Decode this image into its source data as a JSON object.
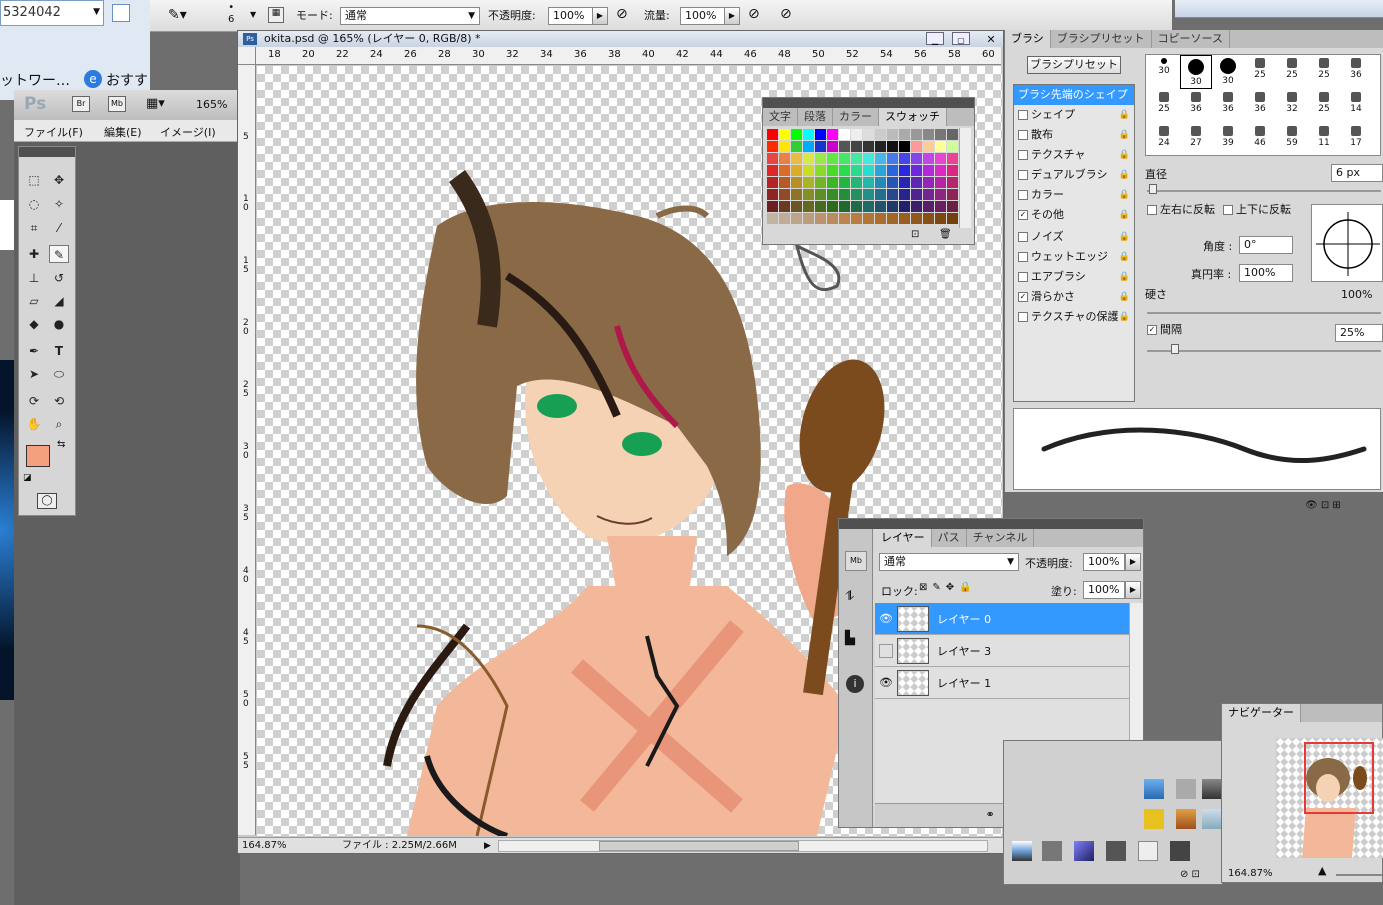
{
  "colors": {
    "accent": "#3399ff",
    "fg_swatch": "#f4a07e"
  },
  "browser": {
    "number": "5324042",
    "network": "ットワー…",
    "favorites": "おすすめサイト"
  },
  "options": {
    "mode_label": "モード:",
    "mode_value": "通常",
    "opacity_label": "不透明度:",
    "opacity_value": "100%",
    "flow_label": "流量:",
    "flow_value": "100%",
    "brush_size": "6"
  },
  "app": {
    "ps_logo": "Ps",
    "br": "Br",
    "mb": "Mb",
    "zoom": "165%",
    "menu": [
      "ファイル(F)",
      "編集(E)",
      "イメージ(I)"
    ]
  },
  "document": {
    "title": "okita.psd @ 165% (レイヤー 0, RGB/8) *",
    "ruler_top": [
      "18",
      "20",
      "22",
      "24",
      "26",
      "28",
      "30",
      "32",
      "34",
      "36",
      "38",
      "40",
      "42",
      "44",
      "46",
      "48",
      "50",
      "52",
      "54",
      "56",
      "58",
      "60"
    ],
    "ruler_left": [
      "5",
      "10",
      "15",
      "20",
      "25",
      "30",
      "35",
      "40",
      "45",
      "50",
      "55"
    ],
    "status_zoom": "164.87%",
    "status_file": "ファイル : 2.25M/2.66M"
  },
  "swatch_panel": {
    "tabs": [
      "文字",
      "段落",
      "カラー",
      "スウォッチ"
    ]
  },
  "brush_panel": {
    "tabs": [
      "ブラシ",
      "ブラシプリセット",
      "コピーソース"
    ],
    "preset_button": "ブラシプリセット",
    "options": [
      {
        "label": "ブラシ先端のシェイプ",
        "checked": false,
        "active": true
      },
      {
        "label": "シェイプ",
        "checked": false
      },
      {
        "label": "散布",
        "checked": false
      },
      {
        "label": "テクスチャ",
        "checked": false
      },
      {
        "label": "デュアルブラシ",
        "checked": false
      },
      {
        "label": "カラー",
        "checked": false
      },
      {
        "label": "その他",
        "checked": true
      },
      {
        "label": "ノイズ",
        "checked": false
      },
      {
        "label": "ウェットエッジ",
        "checked": false
      },
      {
        "label": "エアブラシ",
        "checked": false
      },
      {
        "label": "滑らかさ",
        "checked": true
      },
      {
        "label": "テクスチャの保護",
        "checked": false
      }
    ],
    "tip_sizes": [
      "30",
      "30",
      "30",
      "25",
      "25",
      "25",
      "36",
      "25",
      "36",
      "36",
      "36",
      "32",
      "25",
      "14",
      "24",
      "27",
      "39",
      "46",
      "59",
      "11",
      "17"
    ],
    "diameter_label": "直径",
    "diameter_value": "6 px",
    "flip_x": "左右に反転",
    "flip_y": "上下に反転",
    "angle_label": "角度 :",
    "angle_value": "0°",
    "roundness_label": "真円率 :",
    "roundness_value": "100%",
    "hardness_label": "硬さ",
    "hardness_value": "100%",
    "spacing_label": "間隔",
    "spacing_value": "25%"
  },
  "layers_panel": {
    "tabs": [
      "レイヤー",
      "パス",
      "チャンネル"
    ],
    "blend": "通常",
    "opacity_label": "不透明度:",
    "opacity_value": "100%",
    "lock_label": "ロック:",
    "fill_label": "塗り:",
    "fill_value": "100%",
    "layers": [
      {
        "name": "レイヤー 0",
        "visible": true,
        "selected": true
      },
      {
        "name": "レイヤー 3",
        "visible": false,
        "selected": false
      },
      {
        "name": "レイヤー 1",
        "visible": true,
        "selected": false
      }
    ]
  },
  "navigator": {
    "title": "ナビゲーター",
    "zoom": "164.87%"
  }
}
